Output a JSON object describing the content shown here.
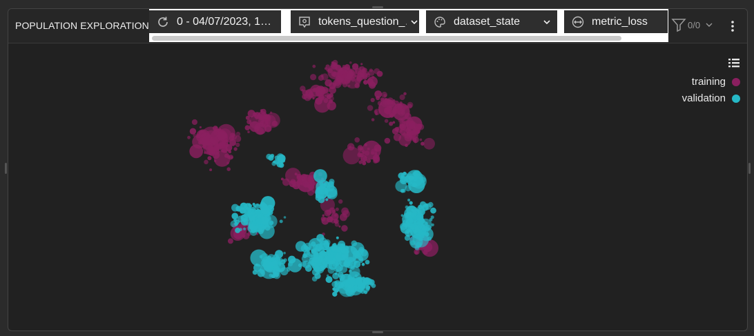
{
  "panel": {
    "title": "POPULATION EXPLORATION"
  },
  "toolbar": {
    "chips": [
      {
        "icon": "refresh-icon",
        "label": "0 - 04/07/2023, 1…"
      },
      {
        "icon": "chat-settings-icon",
        "label": "tokens_question_…"
      },
      {
        "icon": "palette-icon",
        "label": "dataset_state"
      },
      {
        "icon": "size-arrows-icon",
        "label": "metric_loss"
      }
    ],
    "filter_count": "0/0"
  },
  "colors": {
    "training": "#8a1f5f",
    "validation": "#26b8c6",
    "background": "#212121"
  },
  "chart_data": {
    "type": "scatter",
    "legend_position": "top-right",
    "grid": false,
    "series": [
      {
        "name": "training"
      },
      {
        "name": "validation"
      }
    ]
  }
}
